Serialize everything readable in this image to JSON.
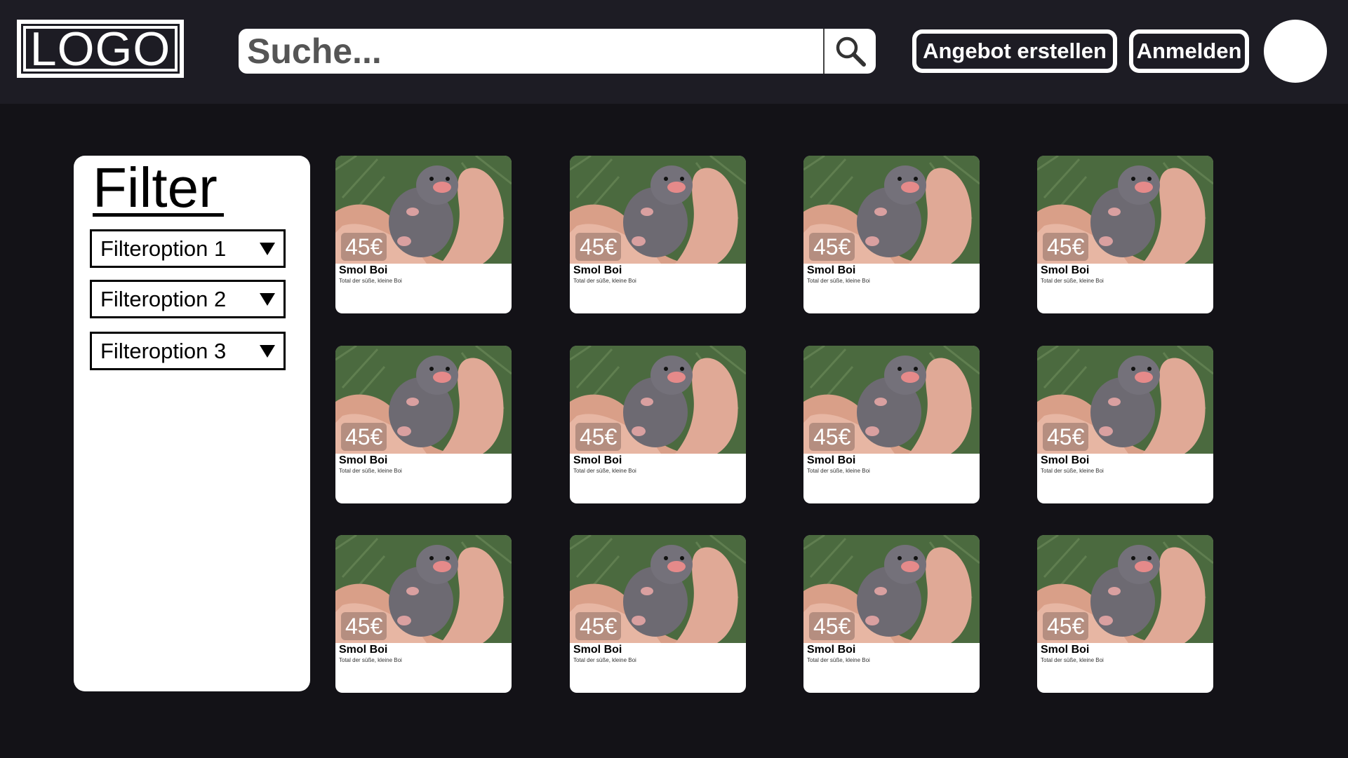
{
  "header": {
    "logo_text": "LOGO",
    "search_placeholder": "Suche...",
    "create_offer_label": "Angebot erstellen",
    "login_label": "Anmelden"
  },
  "filter": {
    "title": "Filter",
    "options": [
      "Filteroption 1",
      "Filteroption 2",
      "Filteroption 3"
    ]
  },
  "listings": [
    {
      "price": "45€",
      "title": "Smol Boi",
      "description": "Total der süße, kleine Boi"
    },
    {
      "price": "45€",
      "title": "Smol Boi",
      "description": "Total der süße, kleine Boi"
    },
    {
      "price": "45€",
      "title": "Smol Boi",
      "description": "Total der süße, kleine Boi"
    },
    {
      "price": "45€",
      "title": "Smol Boi",
      "description": "Total der süße, kleine Boi"
    },
    {
      "price": "45€",
      "title": "Smol Boi",
      "description": "Total der süße, kleine Boi"
    },
    {
      "price": "45€",
      "title": "Smol Boi",
      "description": "Total der süße, kleine Boi"
    },
    {
      "price": "45€",
      "title": "Smol Boi",
      "description": "Total der süße, kleine Boi"
    },
    {
      "price": "45€",
      "title": "Smol Boi",
      "description": "Total der süße, kleine Boi"
    },
    {
      "price": "45€",
      "title": "Smol Boi",
      "description": "Total der süße, kleine Boi"
    },
    {
      "price": "45€",
      "title": "Smol Boi",
      "description": "Total der süße, kleine Boi"
    },
    {
      "price": "45€",
      "title": "Smol Boi",
      "description": "Total der süße, kleine Boi"
    },
    {
      "price": "45€",
      "title": "Smol Boi",
      "description": "Total der süße, kleine Boi"
    }
  ],
  "icons": {
    "search": "search-icon",
    "dropdown": "caret-down-icon"
  },
  "colors": {
    "page_bg": "#131217",
    "header_bg": "#1d1c24",
    "card_bg": "#ffffff"
  }
}
